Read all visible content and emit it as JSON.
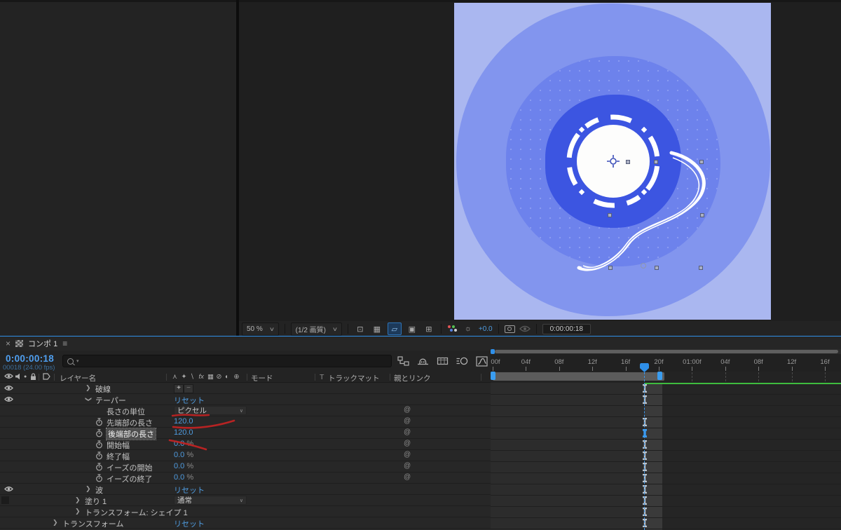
{
  "colors": {
    "accent_blue": "#2f8fe8",
    "value_blue": "#4f9ce0",
    "cache_green": "#3ebc3e",
    "annotation_red": "#c32323",
    "comp_bg_light": "#aab7f0",
    "comp_ring_outer": "#8295ee",
    "comp_ring_mid": "#6d82ec",
    "comp_ring_dark": "#3c55e1",
    "comp_center": "#fdfdfc"
  },
  "viewer": {
    "zoom_label": "50 %",
    "quality_label": "(1/2 画質)",
    "exposure_value": "+0.0",
    "timecode": "0:00:00:18",
    "icon_names": [
      "zoom-fit-icon",
      "transparency-grid-icon",
      "mask-outline-toggle-icon",
      "region-of-interest-icon",
      "grid-guides-icon",
      "channel-rgb-icon",
      "exposure-icon",
      "snapshot-camera-icon",
      "show-snapshot-icon"
    ]
  },
  "timeline": {
    "tab": {
      "close": "×",
      "title": "コンポ 1",
      "menu": "≡"
    },
    "time_display": "0:00:00:18",
    "frame_display": "00018 (24.00 fps)",
    "quick_icon_names": [
      "composition-mini-flowchart-icon",
      "shy-layers-icon",
      "frame-blend-icon",
      "motion-blur-icon",
      "graph-editor-icon"
    ],
    "header": {
      "layer_name": "レイヤー名",
      "mode": "モード",
      "track_matte_t": "T",
      "track_matte": "トラックマット",
      "parent_link": "親とリンク",
      "av_icon_names": [
        "eye-icon",
        "speaker-icon",
        "solo-icon",
        "lock-icon",
        "label-tag-icon"
      ],
      "switch_icon_names": [
        "shy-icon",
        "collapse-icon",
        "quality-icon",
        "fx-icon",
        "frame-blend-icon",
        "motion-blur-icon",
        "adjustment-layer-icon",
        "3d-layer-icon"
      ],
      "switch_glyphs": [
        "⋏",
        "✦",
        "∖",
        "fx",
        "▦",
        "⊘",
        "◐",
        "⊕"
      ],
      "plus": "＋",
      "minus": "−"
    },
    "rows": [
      {
        "label": "破線",
        "indent": 2,
        "arrow": "collapsed",
        "eye": "eye",
        "value_type": "plusminus",
        "value": "",
        "keyframe": "normal"
      },
      {
        "label": "テーパー",
        "indent": 2,
        "arrow": "expanded",
        "eye": "eye",
        "value_type": "reset",
        "value": "リセット",
        "keyframe": "normal"
      },
      {
        "label": "長さの単位",
        "indent": 3,
        "arrow": "none",
        "eye": "none",
        "value_type": "dropdown",
        "value": "ピクセル",
        "pickwhip": true,
        "keyframe": "none"
      },
      {
        "label": "先端部の長さ",
        "indent": 3,
        "arrow": "none",
        "eye": "none",
        "stopwatch": true,
        "value_type": "number",
        "value": "120.0",
        "pickwhip": true,
        "keyframe": "normal"
      },
      {
        "label": "後端部の長さ",
        "indent": 3,
        "arrow": "none",
        "eye": "none",
        "stopwatch": true,
        "selected": true,
        "value_type": "number",
        "value": "120.0",
        "pickwhip": true,
        "keyframe": "selected"
      },
      {
        "label": "開始幅",
        "indent": 3,
        "arrow": "none",
        "eye": "none",
        "stopwatch": true,
        "value_type": "number",
        "value": "0.0",
        "suffix": "%",
        "pickwhip": true,
        "keyframe": "normal"
      },
      {
        "label": "終了幅",
        "indent": 3,
        "arrow": "none",
        "eye": "none",
        "stopwatch": true,
        "value_type": "number",
        "value": "0.0",
        "suffix": "%",
        "pickwhip": true,
        "keyframe": "normal"
      },
      {
        "label": "イーズの開始",
        "indent": 3,
        "arrow": "none",
        "eye": "none",
        "stopwatch": true,
        "value_type": "number",
        "value": "0.0",
        "suffix": "%",
        "pickwhip": true,
        "keyframe": "normal"
      },
      {
        "label": "イーズの終了",
        "indent": 3,
        "arrow": "none",
        "eye": "none",
        "stopwatch": true,
        "value_type": "number",
        "value": "0.0",
        "suffix": "%",
        "pickwhip": true,
        "keyframe": "normal"
      },
      {
        "label": "波",
        "indent": 2,
        "arrow": "collapsed",
        "eye": "eye",
        "value_type": "reset",
        "value": "リセット",
        "keyframe": "normal"
      },
      {
        "label": "塗り 1",
        "indent": 1,
        "arrow": "collapsed",
        "eye": "box",
        "value_type": "dropdown",
        "value": "通常",
        "keyframe": "normal"
      },
      {
        "label": "トランスフォーム: シェイプ 1",
        "indent": 1,
        "arrow": "collapsed",
        "eye": "none",
        "value_type": "none",
        "value": "",
        "keyframe": "normal"
      },
      {
        "label": "トランスフォーム",
        "indent": 0,
        "arrow": "collapsed",
        "eye": "none",
        "value_type": "reset",
        "value": "リセット",
        "keyframe": "normal"
      }
    ],
    "ruler_ticks": [
      "0:00f",
      "04f",
      "08f",
      "12f",
      "16f",
      "20f",
      "01:00f",
      "04f",
      "08f",
      "12f",
      "16f"
    ]
  }
}
